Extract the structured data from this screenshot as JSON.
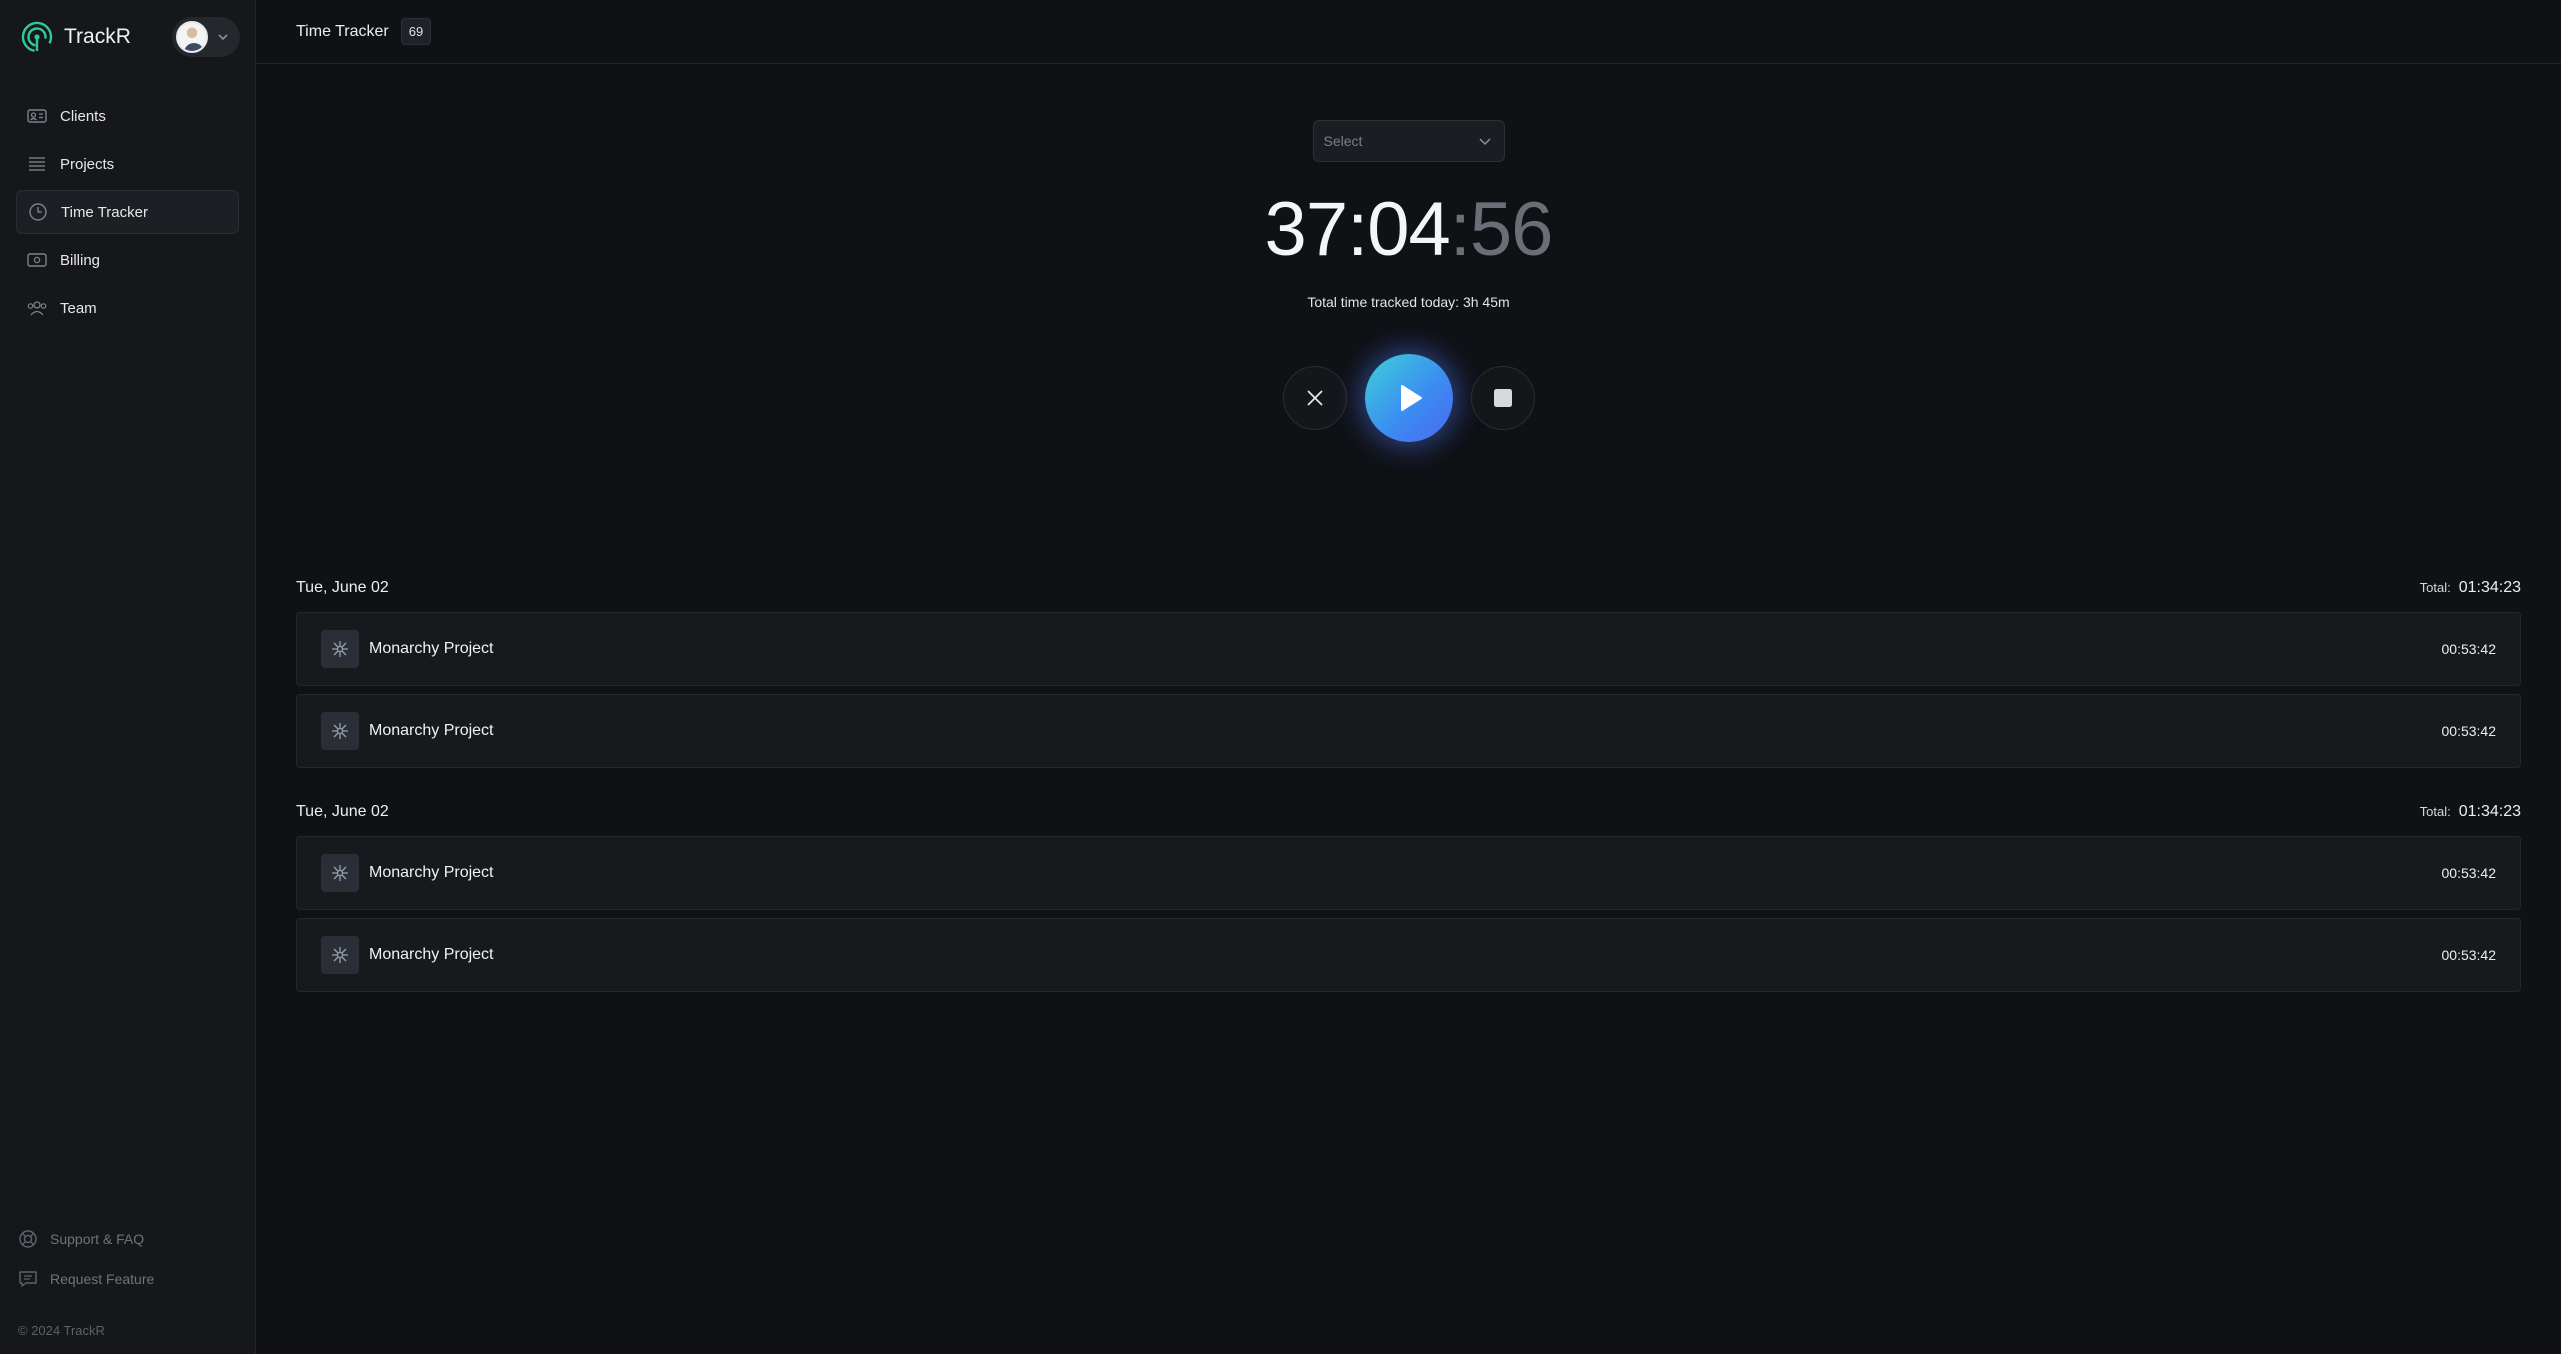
{
  "brand": {
    "name": "TrackR"
  },
  "sidebar": {
    "items": [
      {
        "label": "Clients",
        "icon": "id-card-icon"
      },
      {
        "label": "Projects",
        "icon": "list-icon"
      },
      {
        "label": "Time Tracker",
        "icon": "clock-icon",
        "active": true
      },
      {
        "label": "Billing",
        "icon": "money-icon"
      },
      {
        "label": "Team",
        "icon": "users-icon"
      }
    ],
    "bottom": [
      {
        "label": "Support & FAQ",
        "icon": "lifebuoy-icon"
      },
      {
        "label": "Request Feature",
        "icon": "message-icon"
      }
    ],
    "copyright": "© 2024 TrackR"
  },
  "header": {
    "title": "Time Tracker",
    "badge": "69"
  },
  "tracker": {
    "select_placeholder": "Select",
    "timer": {
      "hours": "37",
      "minutes": "04",
      "seconds": "56"
    },
    "today": "Total time tracked today: 3h 45m"
  },
  "groups": [
    {
      "date": "Tue, June 02",
      "total_label": "Total:",
      "total": "01:34:23",
      "entries": [
        {
          "name": "Monarchy Project",
          "time": "00:53:42"
        },
        {
          "name": "Monarchy Project",
          "time": "00:53:42"
        }
      ]
    },
    {
      "date": "Tue, June 02",
      "total_label": "Total:",
      "total": "01:34:23",
      "entries": [
        {
          "name": "Monarchy Project",
          "time": "00:53:42"
        },
        {
          "name": "Monarchy Project",
          "time": "00:53:42"
        }
      ]
    }
  ],
  "colors": {
    "accent_start": "#3fd0d6",
    "accent_end": "#4a69f0",
    "brand_green": "#2ec99a"
  }
}
